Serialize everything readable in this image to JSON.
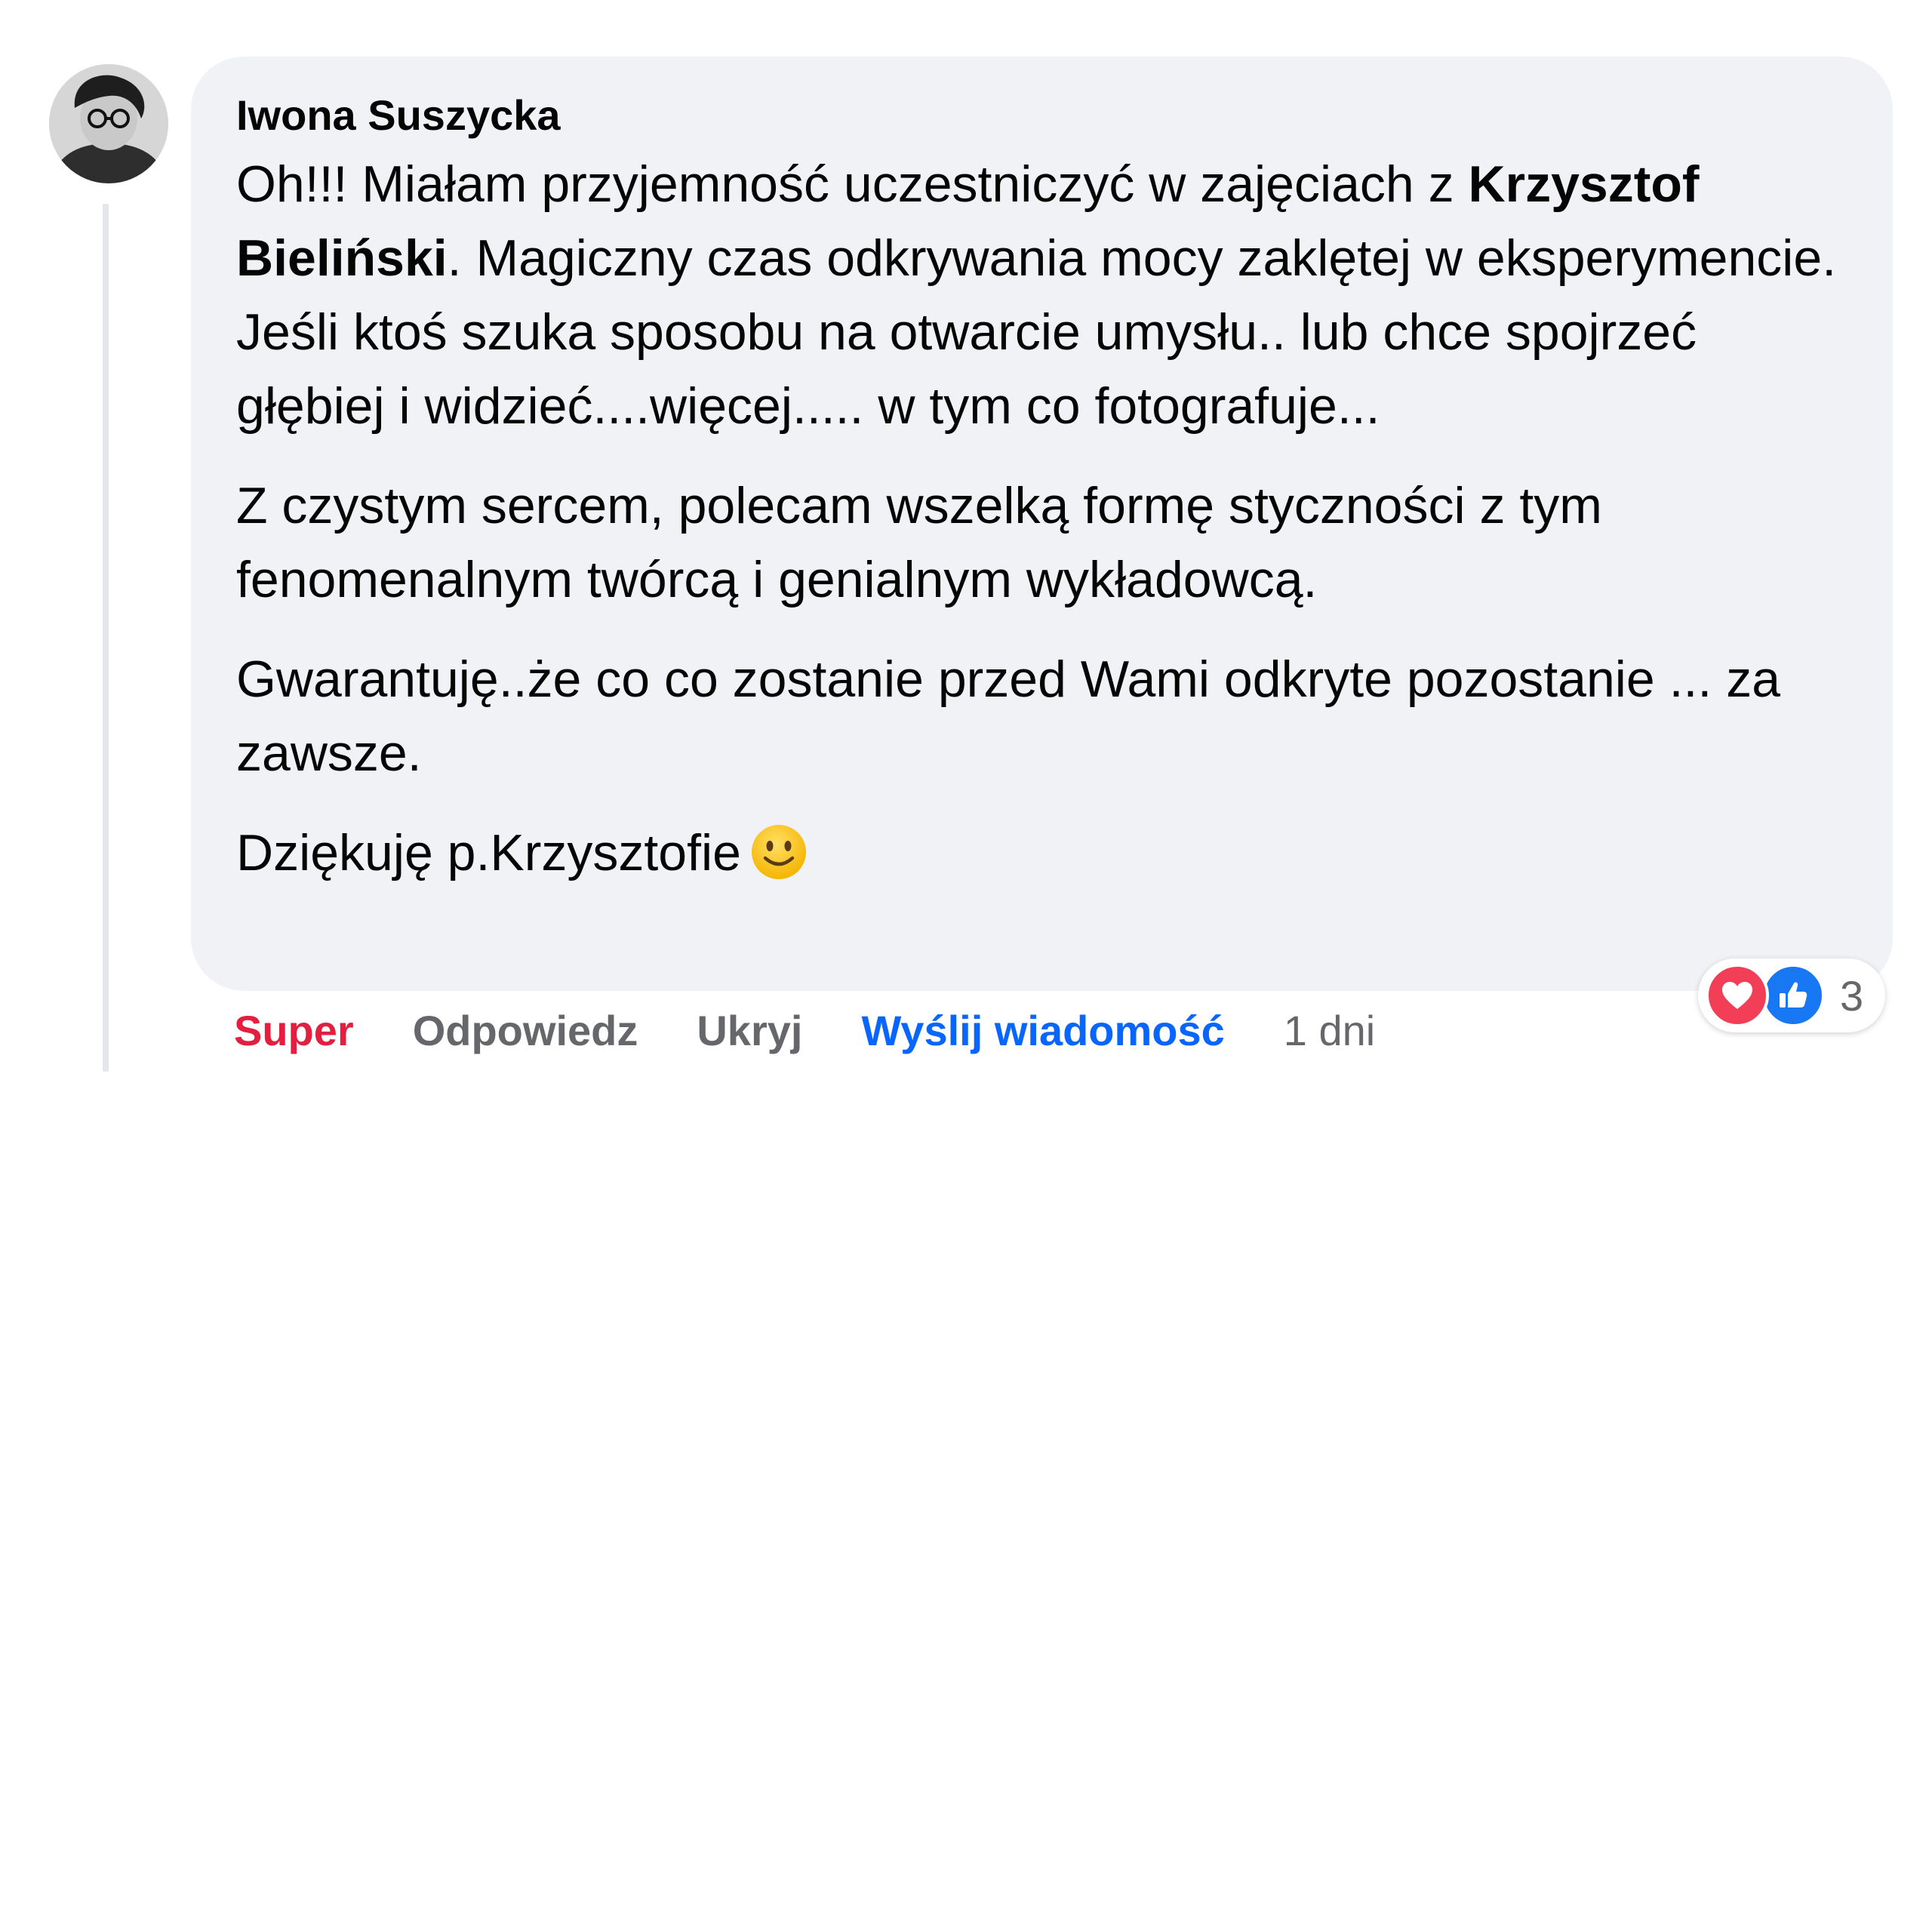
{
  "comment": {
    "author": "Iwona Suszycka",
    "paragraphs": [
      {
        "before": "Oh!!!  Miałam przyjemność uczestniczyć w zajęciach z ",
        "mention": "Krzysztof Bieliński",
        "after": ". Magiczny czas odkrywania mocy zaklętej w eksperymencie.\nJeśli ktoś szuka sposobu na otwarcie umysłu.. lub chce spojrzeć głębiej i widzieć....więcej..... w tym co fotografuje..."
      },
      {
        "text": "Z czystym sercem, polecam wszelką formę styczności z tym fenomenalnym twórcą i genialnym wykładowcą."
      },
      {
        "text": "Gwarantuję..że co co zostanie przed Wami odkryte pozostanie ... za zawsze."
      },
      {
        "text": "Dziękuję p.Krzysztofie",
        "emoji": "slightly-smiling-face-icon"
      }
    ],
    "avatar_icon": "profile-photo"
  },
  "actions": {
    "reaction_label": "Super",
    "reply_label": "Odpowiedz",
    "hide_label": "Ukryj",
    "message_label": "Wyślij wiadomość",
    "time": "1 dni"
  },
  "reactions": {
    "icons": [
      "heart-icon",
      "thumbs-up-icon"
    ],
    "count": "3"
  },
  "colors": {
    "bubble_bg": "#f0f2f5",
    "super": "#e41e3f",
    "link_blue": "#0866ff",
    "muted": "#65676b",
    "love": "#f33e58",
    "like": "#1877f2"
  }
}
